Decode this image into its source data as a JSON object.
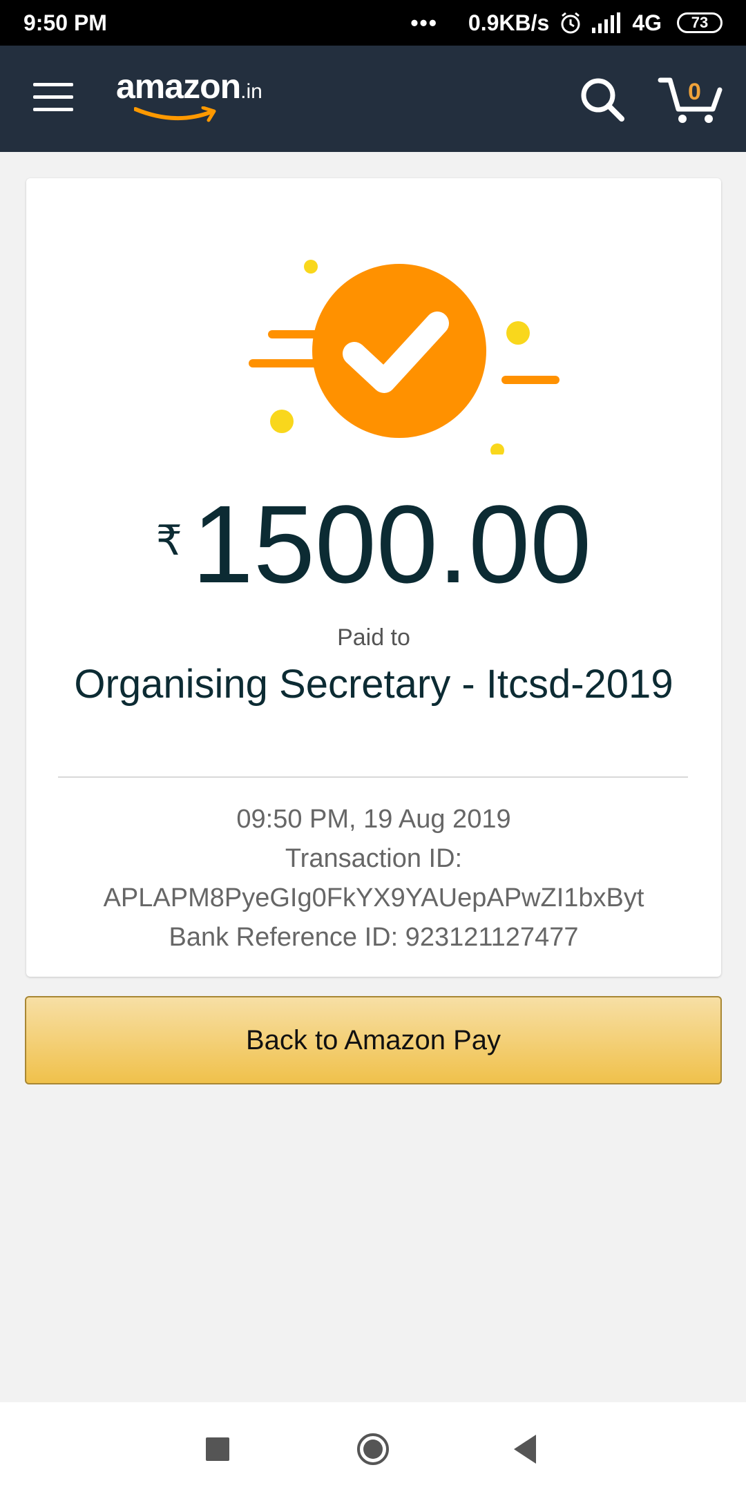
{
  "status_bar": {
    "time": "9:50 PM",
    "dots": "•••",
    "speed": "0.9KB/s",
    "network": "4G",
    "battery": "73",
    "icons": [
      "alarm-icon",
      "signal-icon",
      "battery-icon"
    ]
  },
  "header": {
    "logo_word": "amazon",
    "logo_tld": ".in",
    "cart_count": "0",
    "icons": [
      "menu-icon",
      "search-icon",
      "cart-icon"
    ]
  },
  "payment": {
    "currency_symbol": "₹",
    "amount": "1500.00",
    "paid_to_label": "Paid to",
    "payee": "Organising Secretary - Itcsd-2019",
    "datetime": "09:50 PM, 19 Aug 2019",
    "transaction_label": "Transaction ID:",
    "transaction_id": "APLAPM8PyeGIg0FkYX9YAUepAPwZI1bxByt",
    "bank_reference": "Bank Reference ID: 923121127477"
  },
  "back_button_label": "Back to Amazon Pay",
  "colors": {
    "header_bg": "#232f3e",
    "success_orange": "#ff9100",
    "accent_yellow": "#f9d71c",
    "button_gold": "#f0c14b"
  }
}
